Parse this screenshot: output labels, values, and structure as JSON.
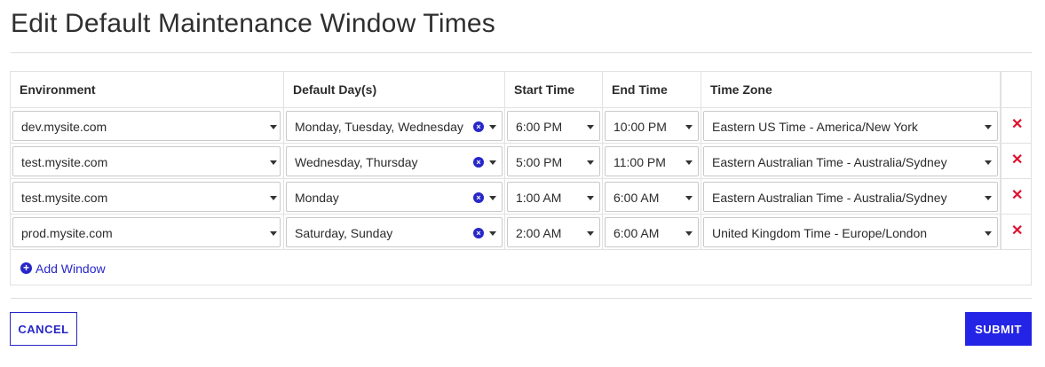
{
  "page": {
    "title": "Edit Default Maintenance Window Times"
  },
  "table": {
    "headers": {
      "environment": "Environment",
      "days": "Default Day(s)",
      "start": "Start Time",
      "end": "End Time",
      "timezone": "Time Zone"
    },
    "rows": [
      {
        "environment": "dev.mysite.com",
        "days": "Monday, Tuesday, Wednesday",
        "start": "6:00 PM",
        "end": "10:00 PM",
        "timezone": "Eastern US Time - America/New York",
        "remove": "✕"
      },
      {
        "environment": "test.mysite.com",
        "days": "Wednesday, Thursday",
        "start": "5:00 PM",
        "end": "11:00 PM",
        "timezone": "Eastern Australian Time - Australia/Sydney",
        "remove": "✕"
      },
      {
        "environment": "test.mysite.com",
        "days": "Monday",
        "start": "1:00 AM",
        "end": "6:00 AM",
        "timezone": "Eastern Australian Time - Australia/Sydney",
        "remove": "✕"
      },
      {
        "environment": "prod.mysite.com",
        "days": "Saturday, Sunday",
        "start": "2:00 AM",
        "end": "6:00 AM",
        "timezone": "United Kingdom Time - Europe/London",
        "remove": "✕"
      }
    ],
    "add_window": {
      "icon": "+",
      "label": "Add Window"
    }
  },
  "icons": {
    "dropdown": "caret-down-icon",
    "clear": "clear-circle-icon",
    "remove": "close-icon",
    "add": "plus-circle-icon"
  },
  "actions": {
    "cancel": "CANCEL",
    "submit": "SUBMIT"
  },
  "colors": {
    "accent": "#2727c9",
    "submit_bg": "#2424e6",
    "delete": "#e0102e"
  }
}
